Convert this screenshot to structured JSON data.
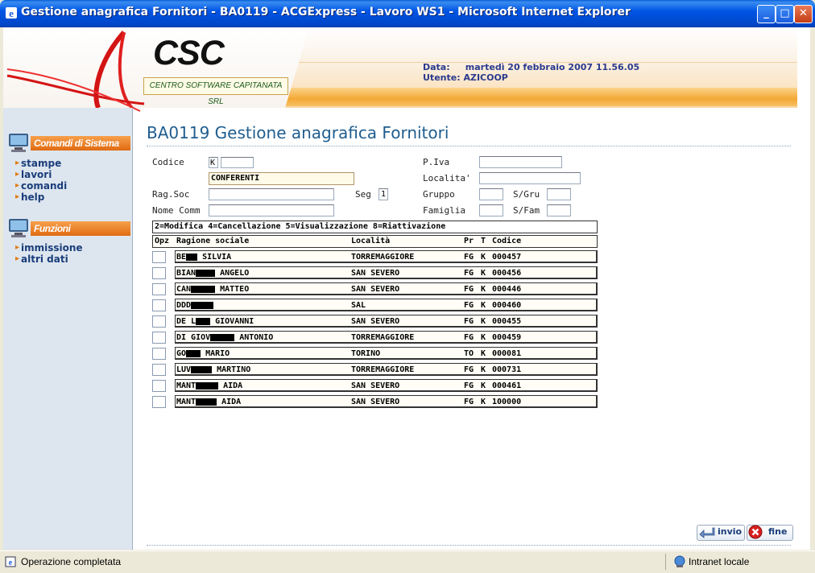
{
  "window": {
    "title": "Gestione anagrafica Fornitori - BA0119 - ACGExpress - Lavoro WS1 - Microsoft Internet Explorer"
  },
  "header": {
    "logo_text": "CSC",
    "logo_sub": "CENTRO SOFTWARE CAPITANATA SRL",
    "data_label": "Data:",
    "data_value": "martedì 20 febbraio 2007 11.56.05",
    "utente_label": "Utente:",
    "utente_value": "AZICOOP"
  },
  "sidebar": {
    "section1": "Comandi di Sistema",
    "links1": [
      "stampe",
      "lavori",
      "comandi",
      "help"
    ],
    "section2": "Funzioni",
    "links2": [
      "immissione",
      "altri dati"
    ]
  },
  "page": {
    "title": "BA0119 Gestione anagrafica Fornitori",
    "form": {
      "codice_label": "Codice",
      "codice_prefix": "K",
      "codice_value": "",
      "tipo_value": "CONFERENTI",
      "ragsoc_label": "Rag.Soc",
      "ragsoc_value": "",
      "seg_label": "Seg",
      "seg_value": "1",
      "nomecomm_label": "Nome Comm",
      "nomecomm_value": "",
      "piva_label": "P.Iva",
      "piva_value": "",
      "localita_label": "Localita'",
      "localita_value": "",
      "gruppo_label": "Gruppo",
      "gruppo_value": "",
      "sgru_label": "S/Gru",
      "sgru_value": "",
      "famiglia_label": "Famiglia",
      "famiglia_value": "",
      "sfam_label": "S/Fam",
      "sfam_value": ""
    },
    "legend": "2=Modifica  4=Cancellazione  5=Visualizzazione  8=Riattivazione",
    "columns": {
      "opz": "Opz",
      "ragione": "Ragione sociale",
      "localita": "Località",
      "pr": "Pr",
      "t": "T",
      "codice": "Codice"
    },
    "rows": [
      {
        "name_a": "BE",
        "name_b": "SILVIA",
        "localita": "TORREMAGGIORE",
        "pr": "FG",
        "t": "K",
        "codice": "000457"
      },
      {
        "name_a": "BIAN",
        "name_b": "ANGELO",
        "localita": "SAN SEVERO",
        "pr": "FG",
        "t": "K",
        "codice": "000456"
      },
      {
        "name_a": "CAN",
        "name_b": "MATTEO",
        "localita": "SAN SEVERO",
        "pr": "FG",
        "t": "K",
        "codice": "000446"
      },
      {
        "name_a": "DDD",
        "name_b": "",
        "localita": "SAL",
        "pr": "FG",
        "t": "K",
        "codice": "000460"
      },
      {
        "name_a": "DE L",
        "name_b": "GIOVANNI",
        "localita": "SAN SEVERO",
        "pr": "FG",
        "t": "K",
        "codice": "000455"
      },
      {
        "name_a": "DI GIOV",
        "name_b": "ANTONIO",
        "localita": "TORREMAGGIORE",
        "pr": "FG",
        "t": "K",
        "codice": "000459"
      },
      {
        "name_a": "GO",
        "name_b": "MARIO",
        "localita": "TORINO",
        "pr": "TO",
        "t": "K",
        "codice": "000081"
      },
      {
        "name_a": "LUV",
        "name_b": "MARTINO",
        "localita": "TORREMAGGIORE",
        "pr": "FG",
        "t": "K",
        "codice": "000731"
      },
      {
        "name_a": "MANT",
        "name_b": "AIDA",
        "localita": "SAN SEVERO",
        "pr": "FG",
        "t": "K",
        "codice": "000461"
      },
      {
        "name_a": "MANT",
        "name_b": "AIDA",
        "localita": "SAN SEVERO",
        "pr": "FG",
        "t": "K",
        "codice": "100000"
      }
    ],
    "buttons": {
      "invio": "invio",
      "fine": "fine"
    }
  },
  "status": {
    "text": "Operazione completata",
    "zone": "Intranet locale"
  }
}
